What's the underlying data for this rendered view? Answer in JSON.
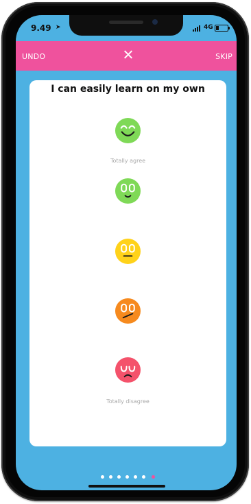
{
  "status_bar": {
    "time": "9.49",
    "network": "4G"
  },
  "top_bar": {
    "undo_label": "UNDO",
    "skip_label": "SKIP",
    "close_icon": "close-icon"
  },
  "card": {
    "question": "I can easily learn on my own",
    "options": [
      {
        "icon": "very-happy-face-icon",
        "color": "#7fd957",
        "caption": "Totally agree"
      },
      {
        "icon": "happy-face-icon",
        "color": "#7fd957",
        "caption": ""
      },
      {
        "icon": "neutral-face-icon",
        "color": "#ffd21a",
        "caption": ""
      },
      {
        "icon": "unsure-face-icon",
        "color": "#f68a1e",
        "caption": ""
      },
      {
        "icon": "sad-face-icon",
        "color": "#f4526b",
        "caption": "Totally disagree"
      }
    ]
  },
  "pagination": {
    "total": 7,
    "active_index": 6,
    "active_color": "#ef529d"
  },
  "colors": {
    "background": "#4db1e2",
    "top_bar": "#ef529d",
    "card": "#ffffff"
  }
}
